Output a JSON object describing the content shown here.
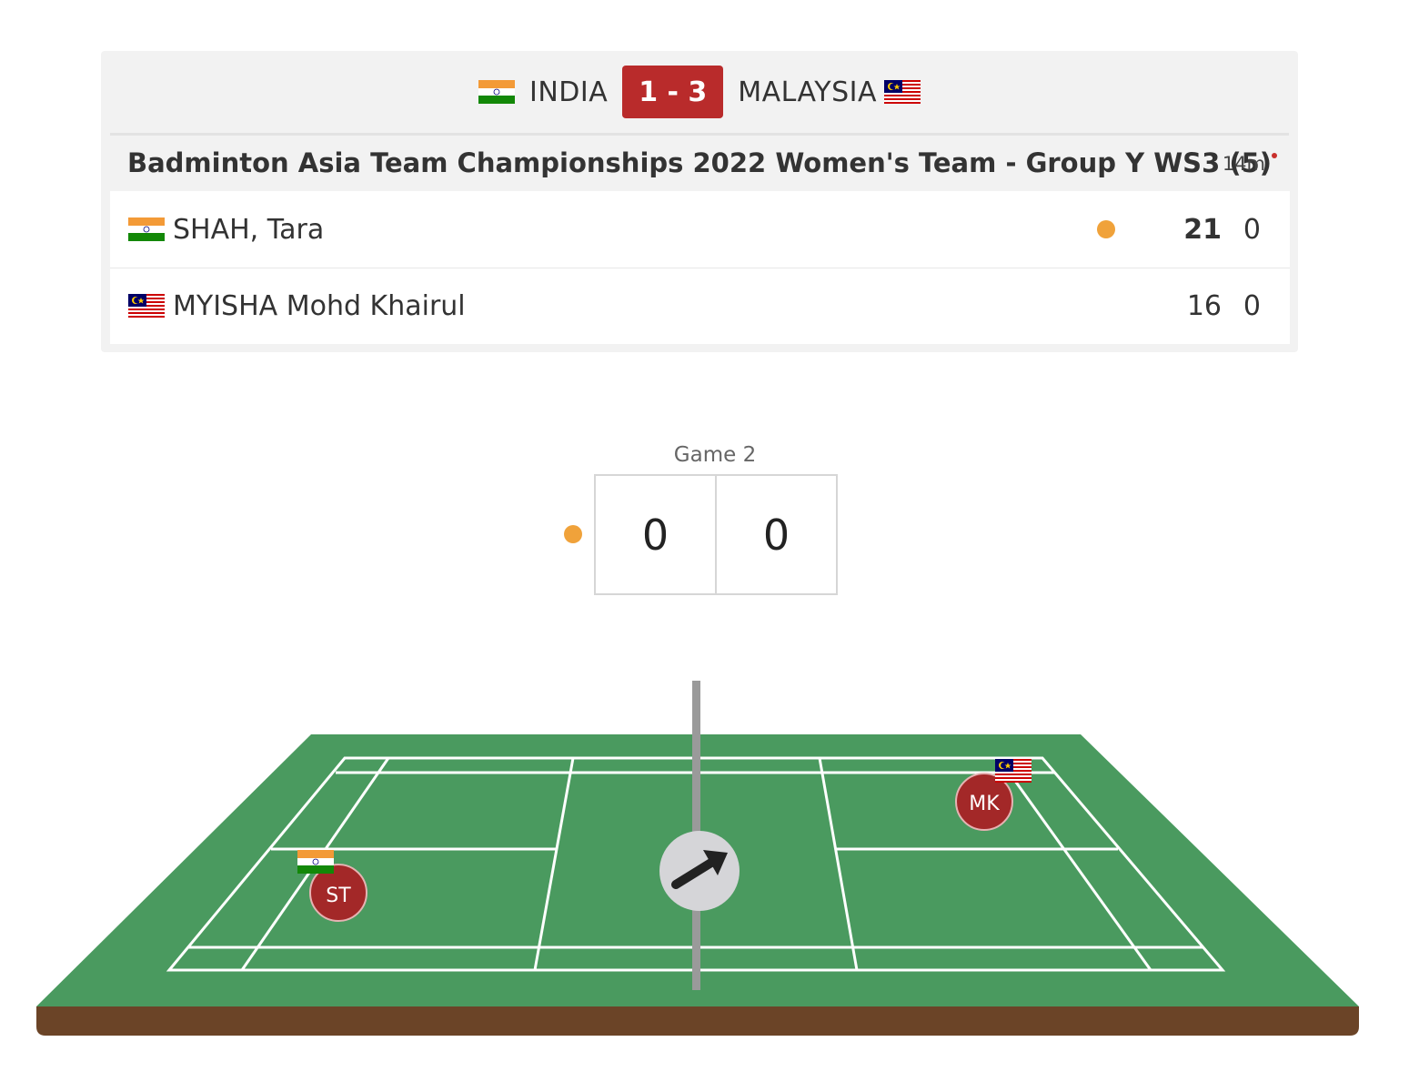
{
  "match": {
    "team_left": {
      "name": "INDIA",
      "flag": "india-flag"
    },
    "team_right": {
      "name": "MALAYSIA",
      "flag": "malaysia-flag"
    },
    "team_score": "1 - 3",
    "event_title": "Badminton Asia Team Championships 2022 Women's Team - Group Y WS3 (5)",
    "duration": "14m",
    "colors": {
      "score_badge": "#b92b2b",
      "serve_indicator": "#f0a23a",
      "court_green": "#4a9a5f",
      "player_marker": "#a32828"
    }
  },
  "players": [
    {
      "name": "SHAH, Tara",
      "flag": "india-flag",
      "serving": true,
      "game1": "21",
      "game2": "0"
    },
    {
      "name": "MYISHA Mohd Khairul",
      "flag": "malaysia-flag",
      "serving": false,
      "game1": "16",
      "game2": "0"
    }
  ],
  "current_game": {
    "label": "Game 2",
    "score_left": "0",
    "score_right": "0"
  },
  "court": {
    "player_left_initials": "ST",
    "player_right_initials": "MK",
    "shuttle_direction_icon": "arrow-up-right-icon"
  }
}
